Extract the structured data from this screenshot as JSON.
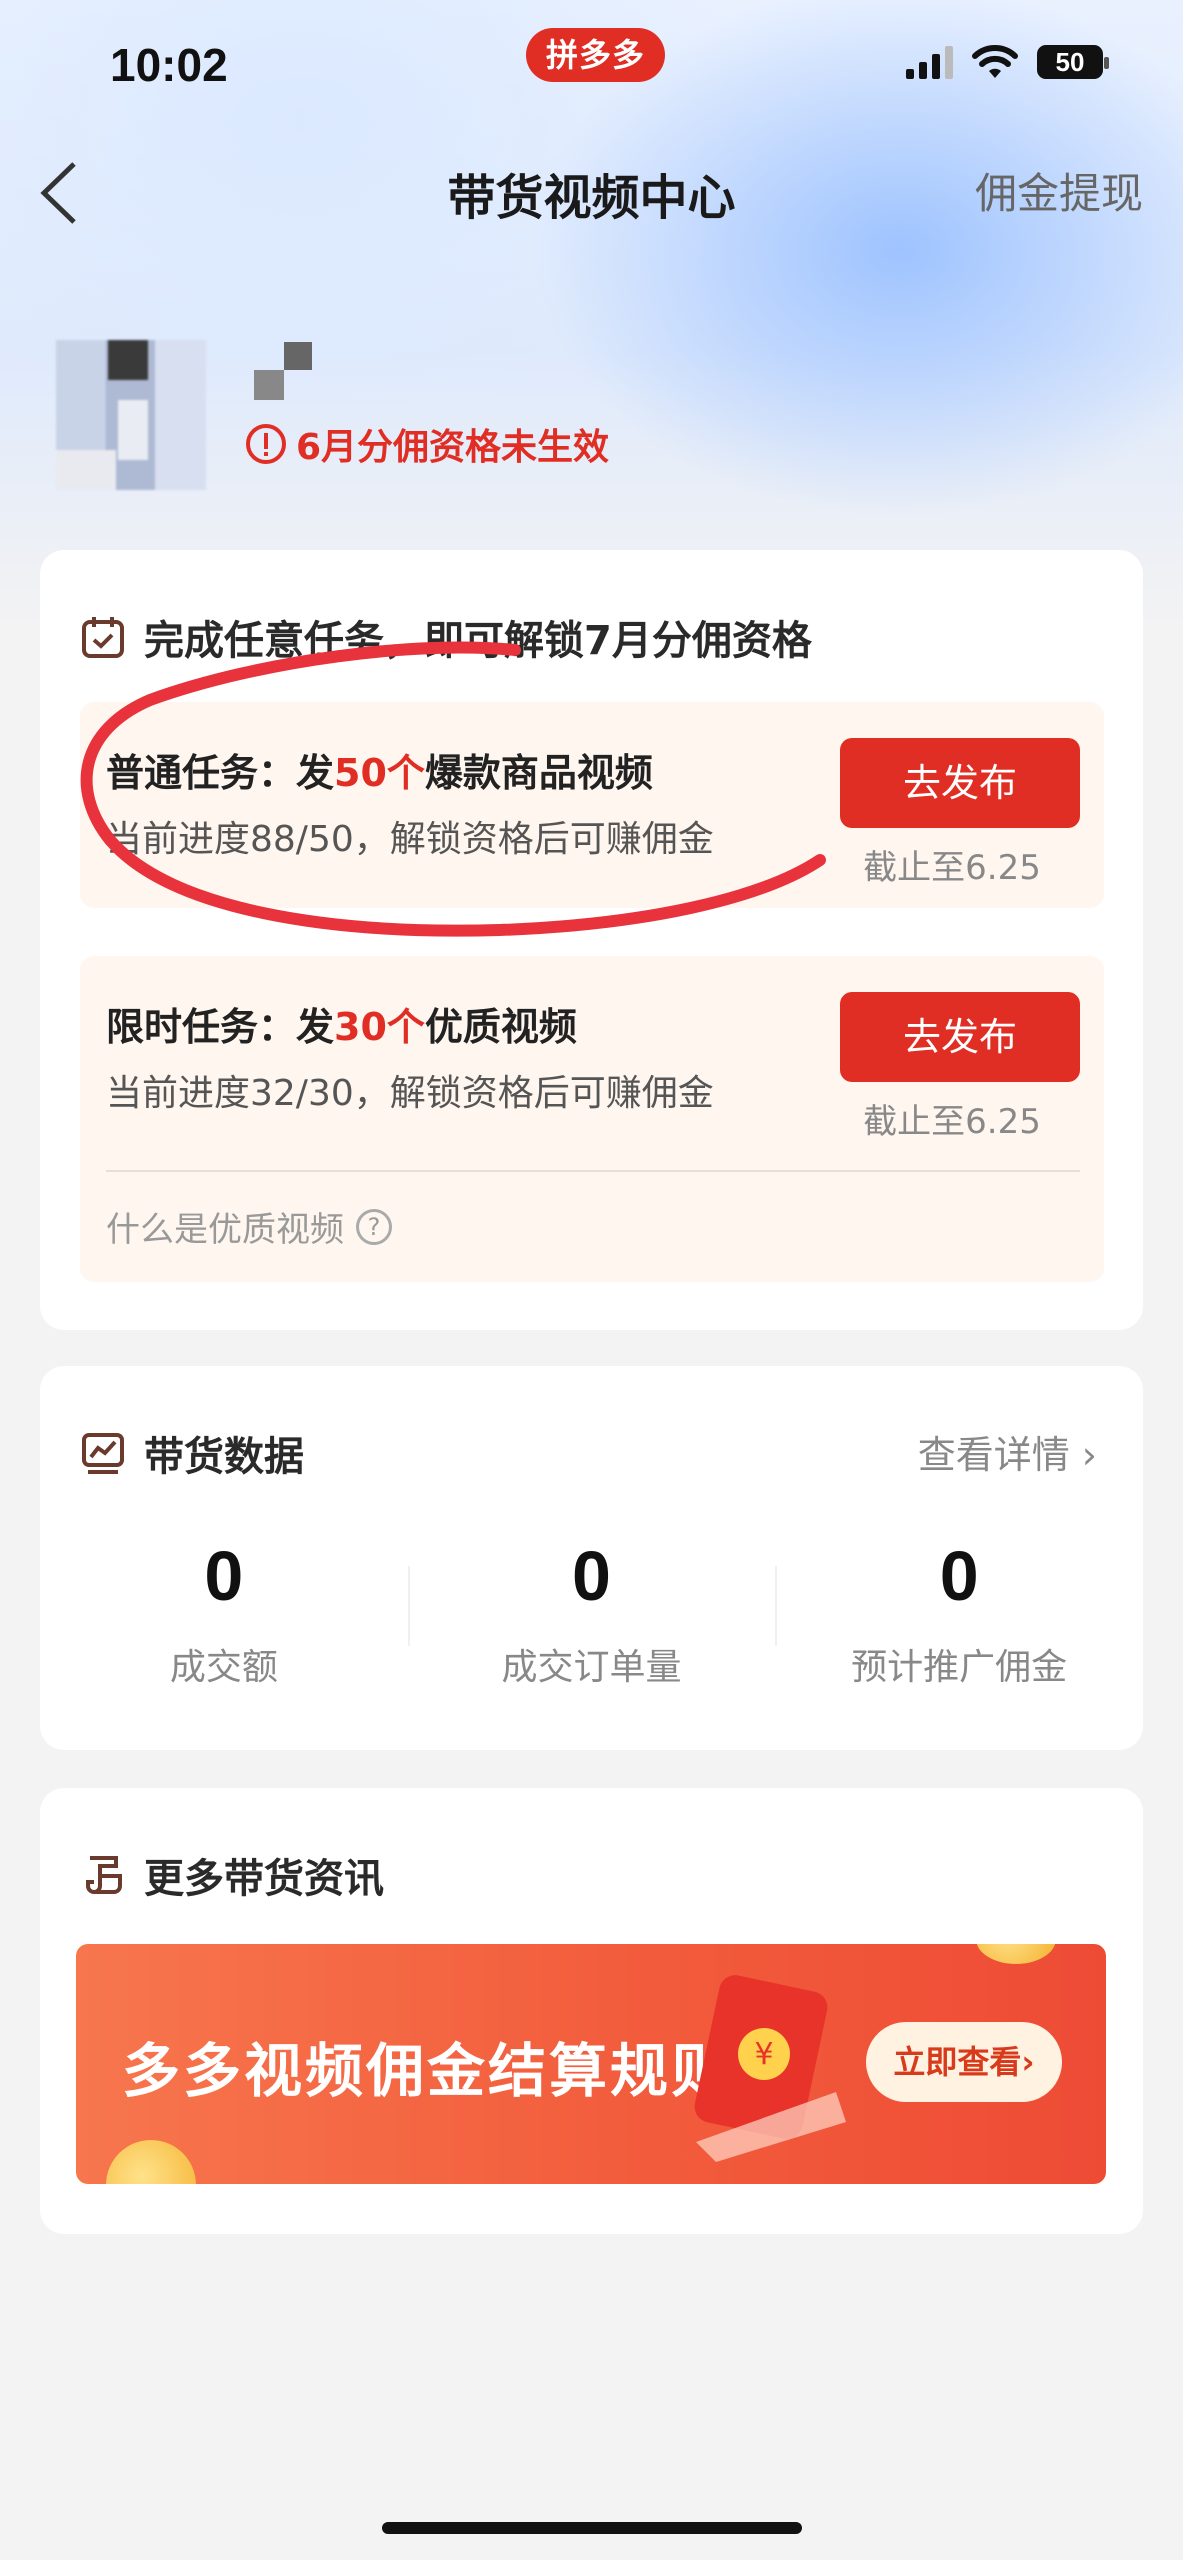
{
  "status_bar": {
    "time": "10:02",
    "app_badge": "拼多多",
    "battery": "50"
  },
  "nav": {
    "title": "带货视频中心",
    "right_action": "佣金提现"
  },
  "profile": {
    "warning": "6月分佣资格未生效"
  },
  "tasks_card": {
    "title": "完成任意任务，即可解锁7月分佣资格",
    "tasks": [
      {
        "title_prefix": "普通任务：发",
        "title_highlight": "50个",
        "title_suffix": "爆款商品视频",
        "progress": "当前进度88/50，解锁资格后可赚佣金",
        "button": "去发布",
        "deadline": "截止至6.25"
      },
      {
        "title_prefix": "限时任务：发",
        "title_highlight": "30个",
        "title_suffix": "优质视频",
        "progress": "当前进度32/30，解锁资格后可赚佣金",
        "button": "去发布",
        "deadline": "截止至6.25",
        "help_link": "什么是优质视频"
      }
    ]
  },
  "data_card": {
    "title": "带货数据",
    "detail_link": "查看详情",
    "stats": [
      {
        "value": "0",
        "label": "成交额"
      },
      {
        "value": "0",
        "label": "成交订单量"
      },
      {
        "value": "0",
        "label": "预计推广佣金"
      }
    ]
  },
  "news_card": {
    "title": "更多带货资讯",
    "banner_text": "多多视频佣金结算规则",
    "banner_button": "立即查看",
    "banner_coin_symbol": "¥"
  },
  "colors": {
    "accent_red": "#e02e24",
    "annotation_red": "#e8333c"
  }
}
